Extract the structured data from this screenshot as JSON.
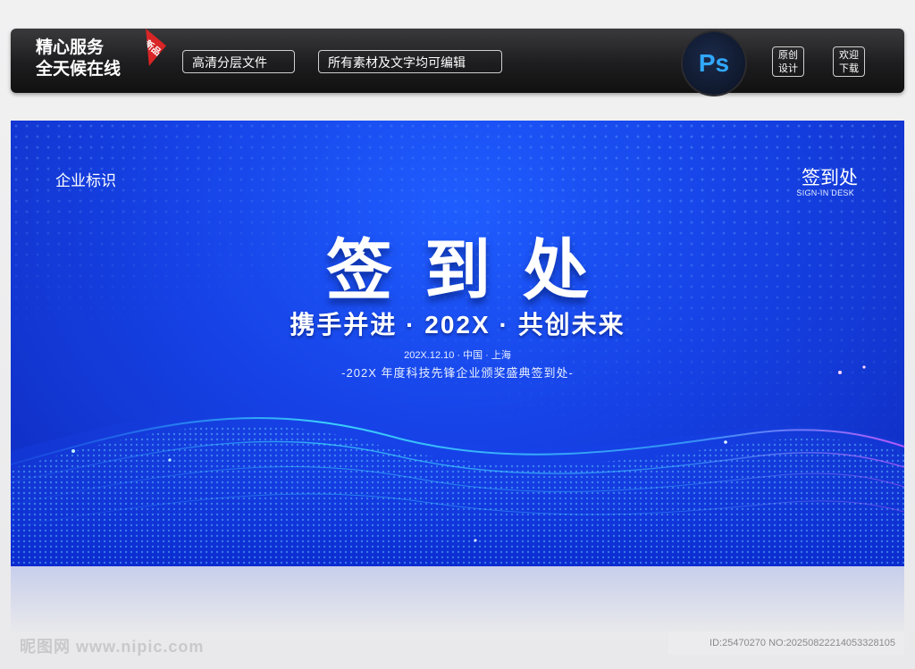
{
  "topbar": {
    "brand_line1": "精心服务",
    "brand_line2": "全天候在线",
    "new_tag": "新品",
    "pill1": "高清分层文件",
    "pill2": "所有素材及文字均可编辑",
    "ps_label": "Ps",
    "tag1_line1": "原创",
    "tag1_line2": "设计",
    "tag2_line1": "欢迎",
    "tag2_line2": "下载"
  },
  "banner": {
    "logo_text": "企业标识",
    "corner_title": "签到处",
    "corner_sub": "SIGN-IN DESK",
    "main_title": "签到处",
    "slogan": "携手并进 · 202X · 共创未来",
    "date_line": "202X.12.10 · 中国 · 上海",
    "event_line": "-202X 年度科技先锋企业颁奖盛典签到处-",
    "colors": {
      "bg_dark": "#0f2bbd",
      "bg_light": "#1f5dff",
      "wave_cyan": "#3fe0ff",
      "wave_purple": "#c85cff"
    }
  },
  "footer": {
    "watermark": "昵图网 www.nipic.com",
    "id_text": "ID:25470270 NO:20250822214053328105"
  }
}
